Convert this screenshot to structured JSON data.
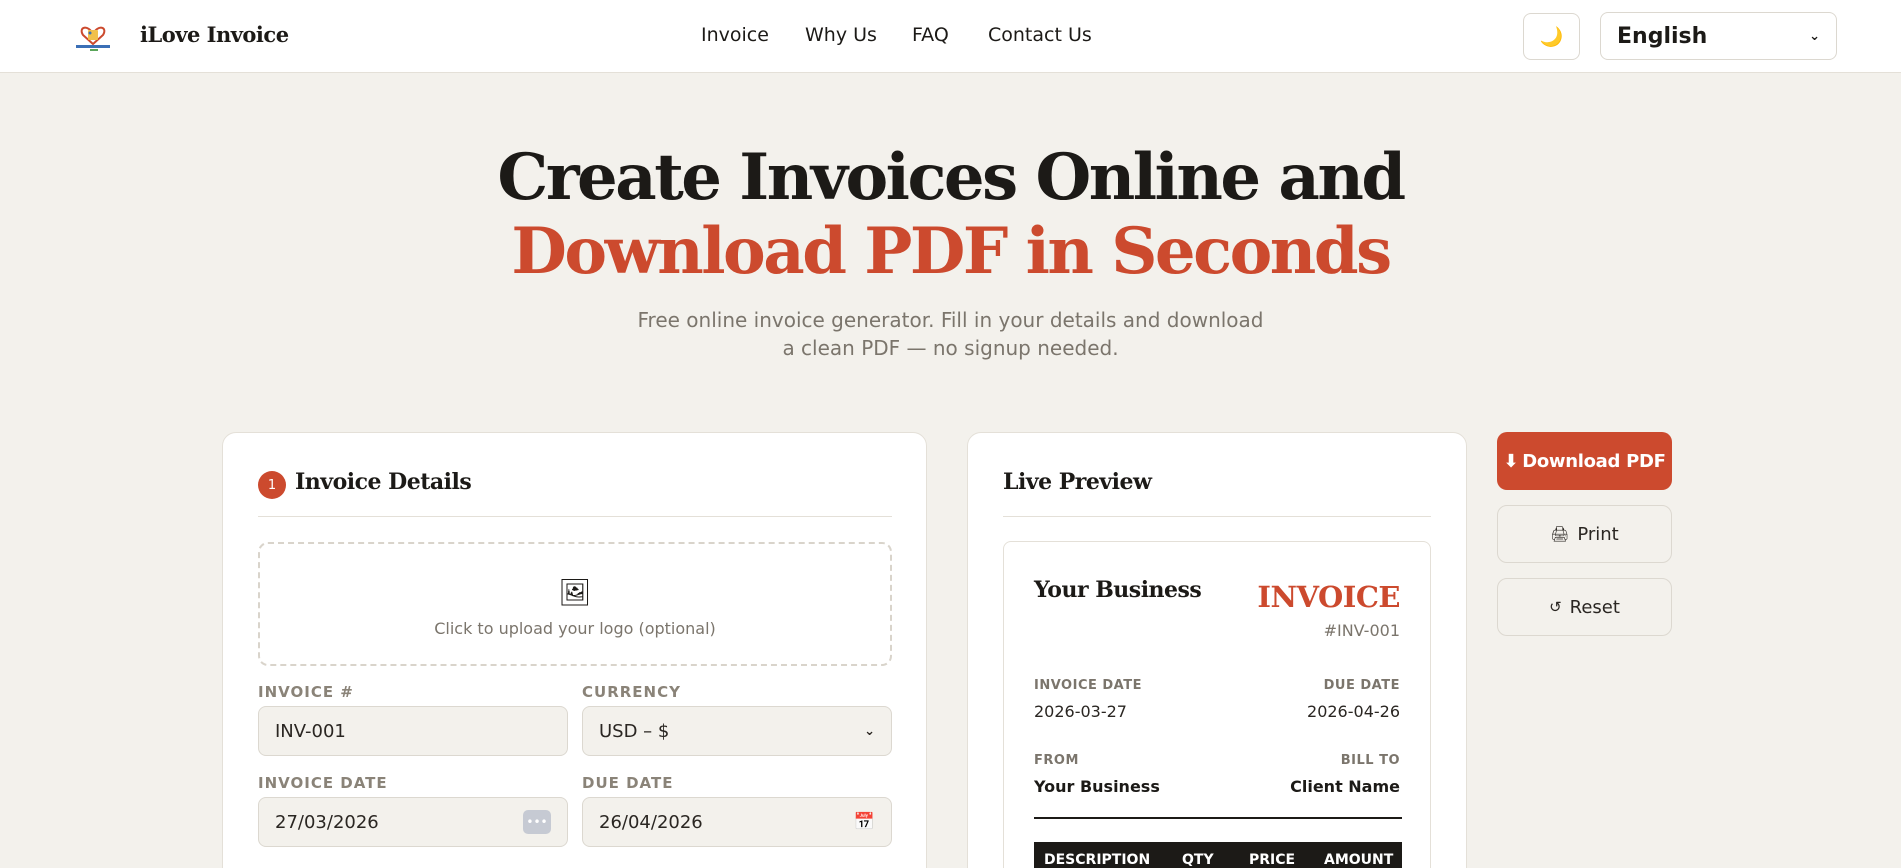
{
  "header": {
    "brand": "iLove Invoice",
    "nav": [
      "Invoice",
      "Why Us",
      "FAQ",
      "Contact Us"
    ],
    "theme_icon": "🌙",
    "language": "English"
  },
  "hero": {
    "line1": "Create Invoices Online and",
    "line2": "Download PDF in Seconds",
    "sub1": "Free online invoice generator. Fill in your details and download",
    "sub2": "a clean PDF — no signup needed."
  },
  "details": {
    "step": "1",
    "title": "Invoice Details",
    "upload_icon": "🖼",
    "upload_text": "Click to upload your logo (optional)",
    "invoice_label": "INVOICE #",
    "invoice_value": "INV-001",
    "currency_label": "CURRENCY",
    "currency_value": "USD – $",
    "date_label": "INVOICE DATE",
    "date_value": "27/03/2026",
    "due_label": "DUE DATE",
    "due_value": "26/04/2026"
  },
  "preview": {
    "title": "Live Preview",
    "business": "Your Business",
    "doc_title": "INVOICE",
    "number": "#INV-001",
    "date_label": "INVOICE DATE",
    "date_value": "2026-03-27",
    "due_label": "DUE DATE",
    "due_value": "2026-04-26",
    "from_label": "FROM",
    "from_value": "Your Business",
    "billto_label": "BILL TO",
    "billto_value": "Client Name",
    "columns": [
      "DESCRIPTION",
      "QTY",
      "PRICE",
      "AMOUNT"
    ]
  },
  "actions": {
    "download": "Download PDF",
    "print": "Print",
    "reset": "Reset"
  }
}
